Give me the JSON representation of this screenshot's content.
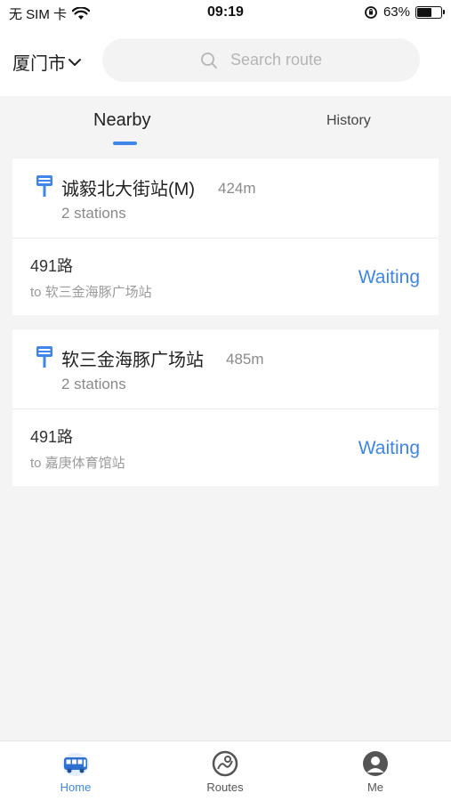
{
  "status_bar": {
    "carrier": "无 SIM 卡",
    "time": "09:19",
    "battery_percent": "63%",
    "battery_level": 0.63
  },
  "header": {
    "city": "厦门市",
    "search_placeholder": "Search route"
  },
  "tabs": {
    "nearby": "Nearby",
    "history": "History",
    "active": "Nearby"
  },
  "colors": {
    "accent": "#3f86e8",
    "background": "#f4f4f4"
  },
  "stations": [
    {
      "name": "诚毅北大街站(M)",
      "distance": "424m",
      "stations_count": "2 stations",
      "route": {
        "name": "491路",
        "destination": "to 软三金海豚广场站",
        "status": "Waiting"
      }
    },
    {
      "name": "软三金海豚广场站",
      "distance": "485m",
      "stations_count": "2 stations",
      "route": {
        "name": "491路",
        "destination": "to 嘉庚体育馆站",
        "status": "Waiting"
      }
    }
  ],
  "bottom_nav": {
    "home": "Home",
    "routes": "Routes",
    "me": "Me",
    "active": "Home"
  }
}
